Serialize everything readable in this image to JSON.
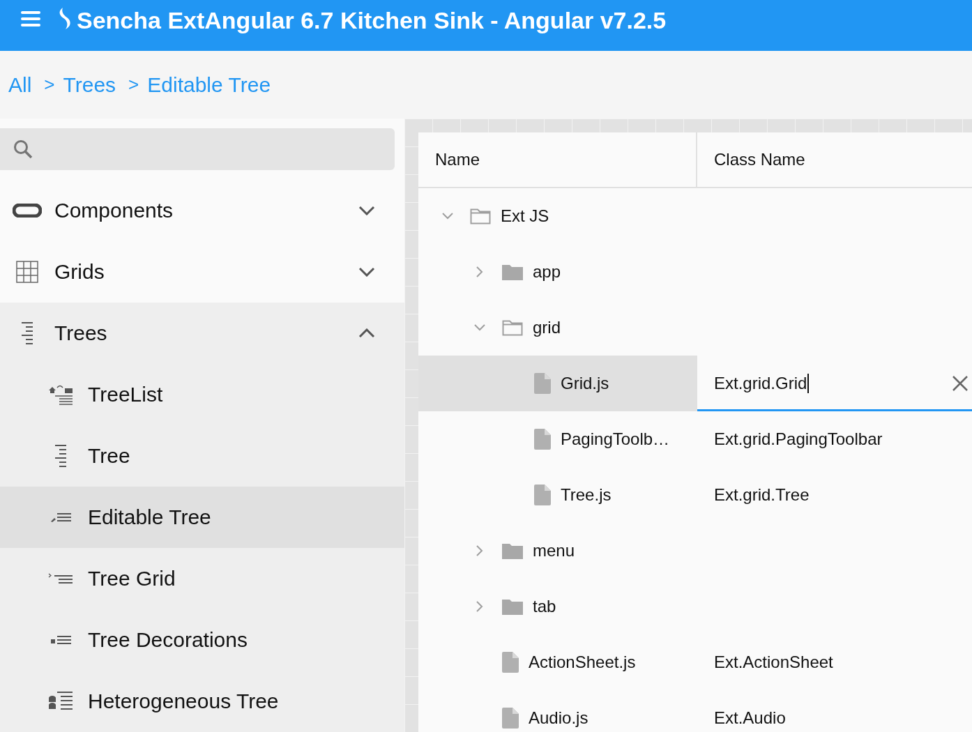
{
  "header": {
    "title": "Sencha ExtAngular 6.7 Kitchen Sink - Angular v7.2.5"
  },
  "breadcrumb": [
    {
      "label": "All"
    },
    {
      "separator": ">",
      "label": "Trees"
    },
    {
      "separator": ">",
      "label": "Editable Tree"
    }
  ],
  "sidebar": {
    "items": [
      {
        "label": "Components",
        "expanded": false
      },
      {
        "label": "Grids",
        "expanded": false
      },
      {
        "label": "Trees",
        "expanded": true,
        "children": [
          {
            "label": "TreeList",
            "selected": false
          },
          {
            "label": "Tree",
            "selected": false
          },
          {
            "label": "Editable Tree",
            "selected": true
          },
          {
            "label": "Tree Grid",
            "selected": false
          },
          {
            "label": "Tree Decorations",
            "selected": false
          },
          {
            "label": "Heterogeneous Tree",
            "selected": false
          }
        ]
      }
    ]
  },
  "tree": {
    "columns": [
      "Name",
      "Class Name"
    ],
    "rows": [
      {
        "kind": "folder",
        "name": "Ext JS",
        "expanded": true,
        "selected": false,
        "children": [
          {
            "kind": "folder",
            "name": "app",
            "expanded": false,
            "selected": false
          },
          {
            "kind": "folder",
            "name": "grid",
            "expanded": true,
            "selected": false,
            "children": [
              {
                "kind": "file",
                "name": "Grid.js",
                "class_name": "Ext.grid.Grid",
                "editing": true,
                "selected": true
              },
              {
                "kind": "file",
                "name": "PagingToolb…",
                "class_name": "Ext.grid.PagingToolbar",
                "editing": false,
                "selected": false
              },
              {
                "kind": "file",
                "name": "Tree.js",
                "class_name": "Ext.grid.Tree",
                "editing": false,
                "selected": false
              }
            ]
          },
          {
            "kind": "folder",
            "name": "menu",
            "expanded": false,
            "selected": false
          },
          {
            "kind": "folder",
            "name": "tab",
            "expanded": false,
            "selected": false
          },
          {
            "kind": "file",
            "name": "ActionSheet.js",
            "class_name": "Ext.ActionSheet",
            "editing": false,
            "selected": false
          },
          {
            "kind": "file",
            "name": "Audio.js",
            "class_name": "Ext.Audio",
            "editing": false,
            "selected": false
          }
        ]
      }
    ]
  }
}
